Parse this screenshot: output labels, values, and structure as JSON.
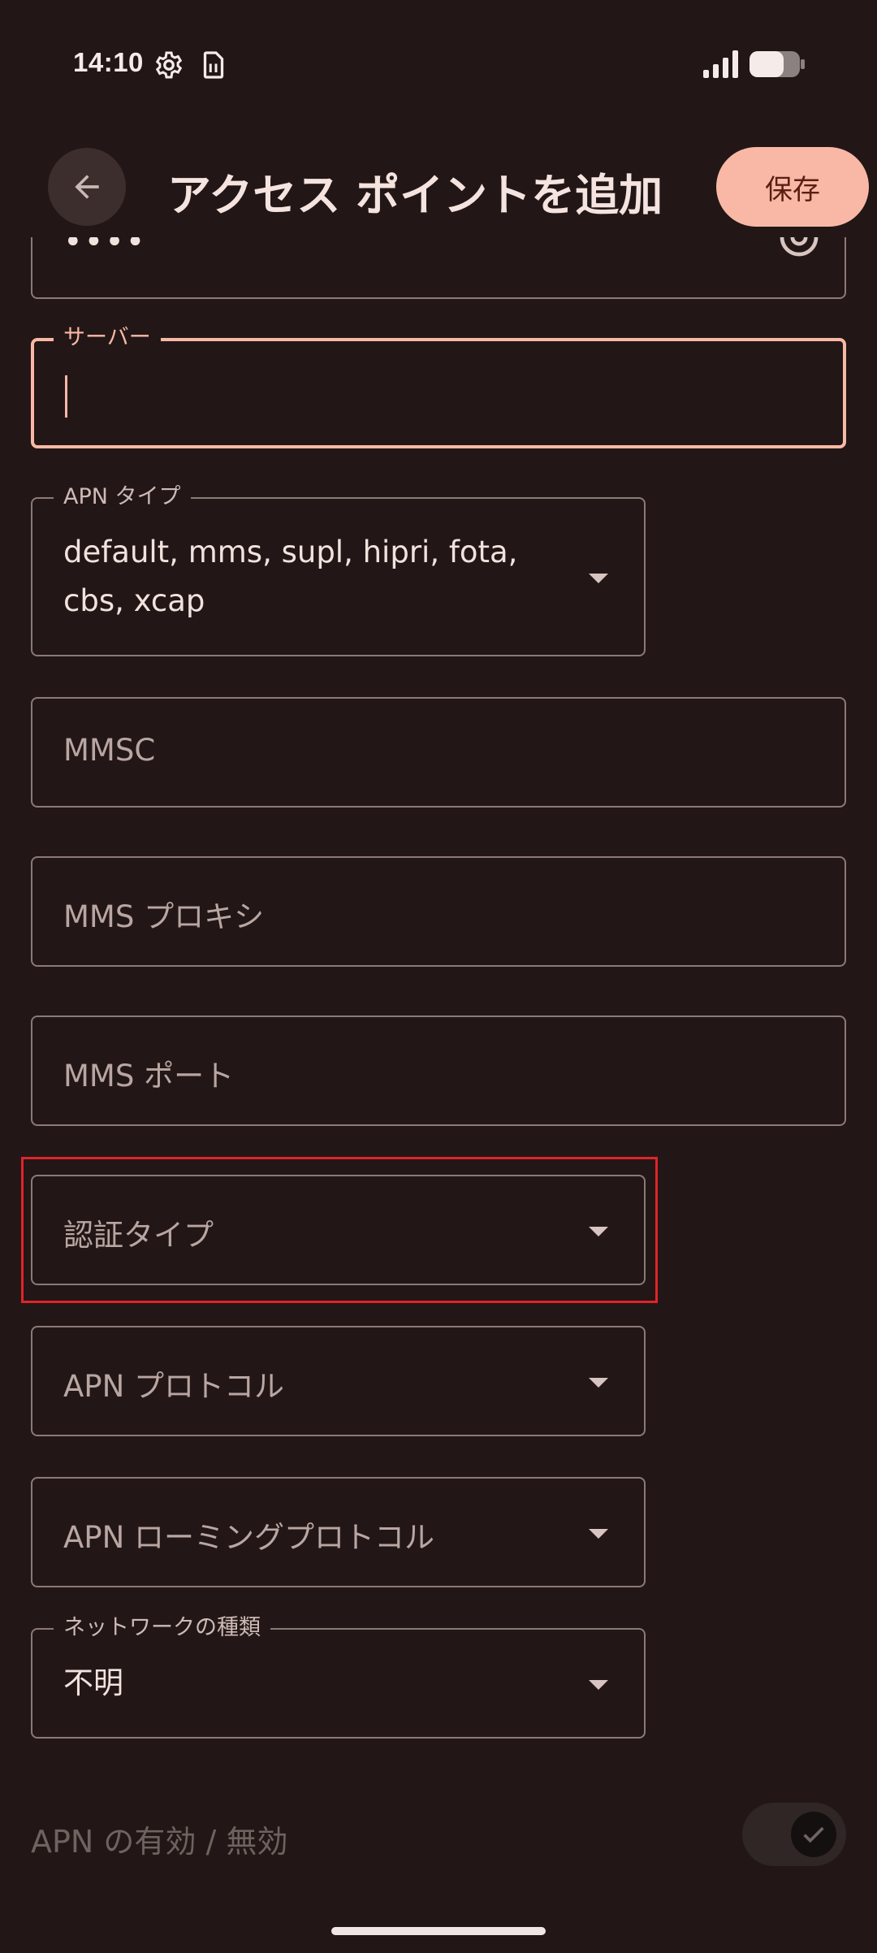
{
  "status_bar": {
    "time": "14:10"
  },
  "app_bar": {
    "title": "アクセス ポイントを追加",
    "save_label": "保存"
  },
  "fields": {
    "password": {
      "value": "••••"
    },
    "server": {
      "label": "サーバー",
      "value": ""
    },
    "apn_type": {
      "label": "APN タイプ",
      "value": "default, mms, supl, hipri, fota,\ncbs, xcap"
    },
    "mmsc": {
      "placeholder": "MMSC"
    },
    "mms_proxy": {
      "placeholder": "MMS プロキシ"
    },
    "mms_port": {
      "placeholder": "MMS ポート"
    },
    "auth_type": {
      "placeholder": "認証タイプ"
    },
    "apn_protocol": {
      "placeholder": "APN プロトコル"
    },
    "apn_roaming_protocol": {
      "placeholder": "APN ローミングプロトコル"
    },
    "network_type": {
      "label": "ネットワークの種類",
      "value": "不明"
    }
  },
  "apn_enable": {
    "label": "APN の有効 / 無効",
    "enabled": true
  },
  "colors": {
    "background": "#221716",
    "accent": "#f9b8a6",
    "highlight": "#e0242a"
  }
}
